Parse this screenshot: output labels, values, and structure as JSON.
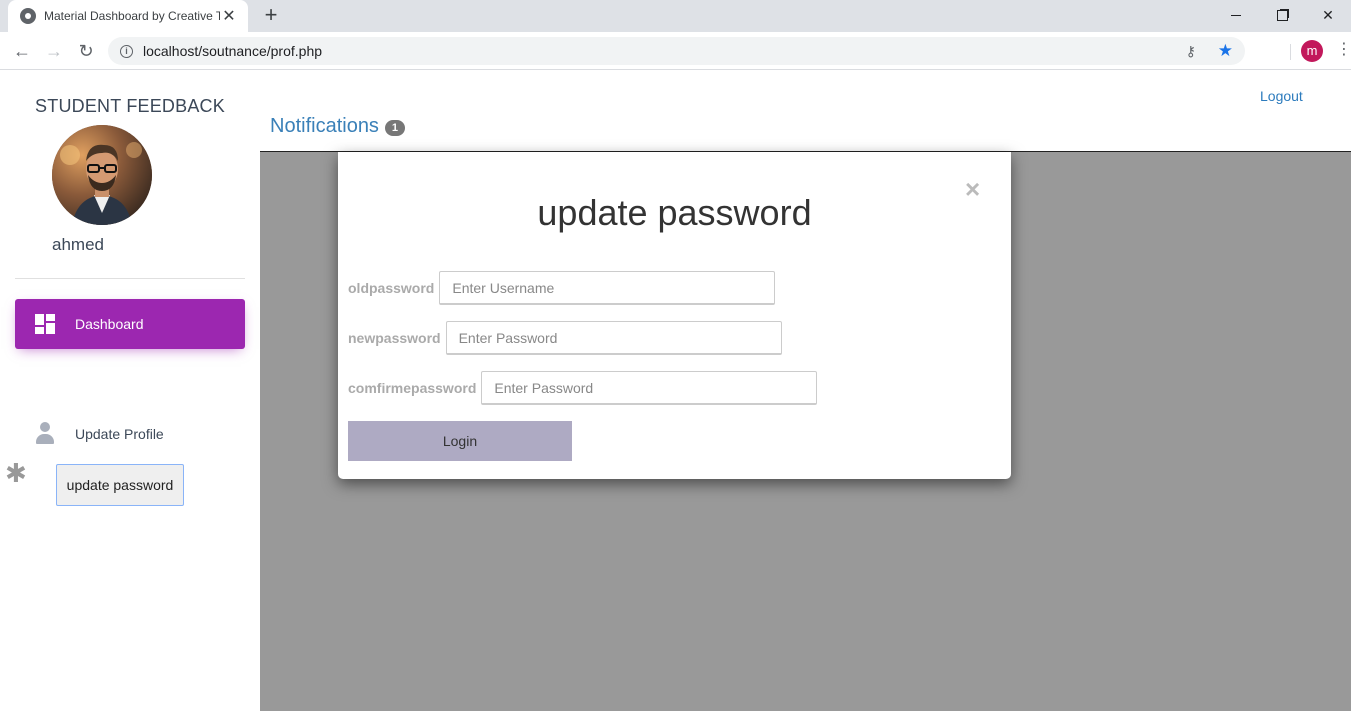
{
  "browser": {
    "tab_title": "Material Dashboard by Creative T",
    "url": "localhost/soutnance/prof.php",
    "profile_initial": "m",
    "icons": [
      "globe-icon",
      "close-icon",
      "plus-icon",
      "back-arrow-icon",
      "forward-arrow-icon",
      "reload-icon",
      "info-icon",
      "key-icon",
      "star-icon",
      "kebab-menu-icon"
    ]
  },
  "sidebar": {
    "brand": "STUDENT FEEDBACK",
    "username": "ahmed",
    "active_item": {
      "label": "Dashboard",
      "icon": "dashboard-icon",
      "color": "#9c27b0"
    },
    "items": [
      {
        "label": "Update Profile",
        "icon": "person-icon"
      },
      {
        "label": "update password",
        "icon": "asterisk-icon"
      }
    ]
  },
  "topnav": {
    "logout": "Logout",
    "notifications": "Notifications",
    "notification_count": "1"
  },
  "modal": {
    "title": "update password",
    "close": "×",
    "fields": [
      {
        "label": "oldpassword",
        "placeholder": "Enter Username"
      },
      {
        "label": "newpassword",
        "placeholder": "Enter Password"
      },
      {
        "label": "comfirmepassword",
        "placeholder": "Enter Password"
      }
    ],
    "submit": "Login"
  }
}
